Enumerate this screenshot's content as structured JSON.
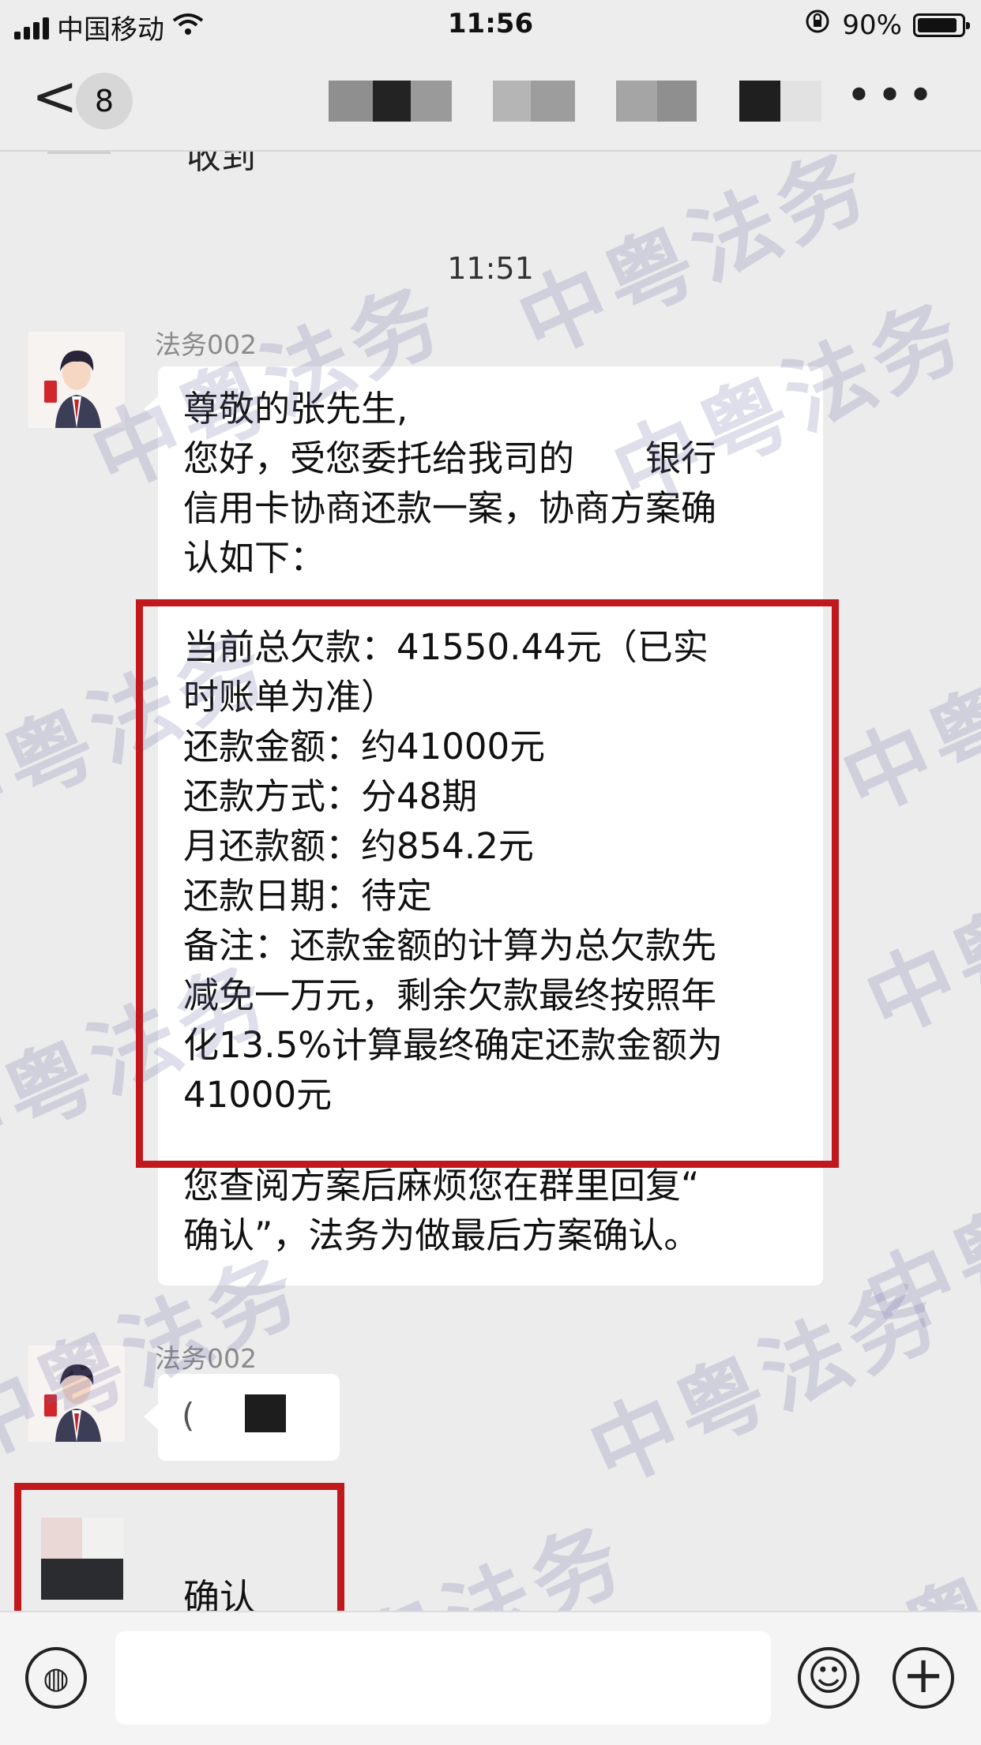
{
  "status_bar": {
    "carrier": "中国移动",
    "time": "11:56",
    "battery_percent": "90%",
    "battery_level": 0.9
  },
  "nav": {
    "back_glyph": "<",
    "unread_count": "8",
    "more_glyph": "•••"
  },
  "chat": {
    "cut_text": "收到",
    "timestamp": "11:51",
    "watermark": "中粤法务",
    "messages": [
      {
        "sender": "法务002",
        "lines_intro": [
          "尊敬的张先生,",
          "您好，受您委托给我司的　　银行",
          "信用卡协商还款一案，协商方案确",
          "认如下："
        ],
        "lines_plan": [
          "当前总欠款：41550.44元（已实",
          "时账单为准）",
          "还款金额：约41000元",
          "还款方式：分48期",
          "月还款额：约854.2元",
          "还款日期：待定",
          "备注：还款金额的计算为总欠款先",
          "减免一万元，剩余欠款最终按照年",
          "化13.5%计算最终确定还款金额为",
          "41000元"
        ],
        "lines_outro": [
          "您查阅方案后麻烦您在群里回复“",
          "确认”，法务为做最后方案确认。"
        ]
      },
      {
        "sender": "法务002",
        "partial": "("
      },
      {
        "text": "确认"
      }
    ]
  },
  "input_bar": {
    "voice_icon": "voice-icon",
    "emoji_icon": "emoji-icon",
    "plus_icon": "plus-icon",
    "voice_glyph": "◍",
    "emoji_glyph": "☺",
    "plus_glyph": "+"
  },
  "colors": {
    "highlight": "#c0181d",
    "background": "#ececec"
  }
}
